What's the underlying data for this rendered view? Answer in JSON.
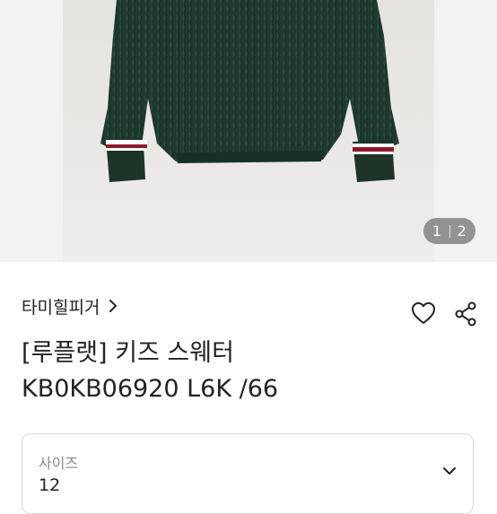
{
  "gallery": {
    "current_page": "1",
    "total_pages": "2",
    "image_subject": "green cable-knit kids sweater with red/white striped cuffs",
    "colors": {
      "sweater": "#1f3a2c",
      "background": "#e9e6e1",
      "stripe_red": "#8c1a2b"
    }
  },
  "product": {
    "brand": "타미힐피거",
    "title_line1": "[루플랫] 키즈 스웨터",
    "title_line2": "KB0KB06920 L6K /66"
  },
  "actions": {
    "like_icon": "heart-icon",
    "share_icon": "share-icon"
  },
  "size_selector": {
    "label": "사이즈",
    "value": "12",
    "icon": "chevron-down-icon"
  }
}
